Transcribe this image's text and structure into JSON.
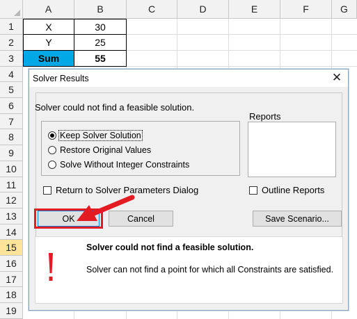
{
  "sheet": {
    "columns": [
      "A",
      "B",
      "C",
      "D",
      "E",
      "F",
      "G"
    ],
    "rows": [
      "1",
      "2",
      "3",
      "4",
      "5",
      "6",
      "7",
      "8",
      "9",
      "10",
      "11",
      "12",
      "13",
      "14",
      "15",
      "16",
      "17",
      "18",
      "19"
    ],
    "active_row": "15",
    "cells": {
      "a1": "X",
      "b1": "30",
      "a2": "Y",
      "b2": "25",
      "a3": "Sum",
      "b3": "55"
    },
    "sum_color": "#00a8e6",
    "active_row_color": "#ffe49a"
  },
  "dialog": {
    "title": "Solver Results",
    "close_icon": "close-icon",
    "message": "Solver could not find a feasible solution.",
    "reports_label": "Reports",
    "options": [
      {
        "label": "Keep Solver Solution",
        "selected": true
      },
      {
        "label": "Restore Original Values",
        "selected": false
      },
      {
        "label": "Solve Without Integer Constraints",
        "selected": false
      }
    ],
    "return_checkbox": "Return to Solver Parameters Dialog",
    "outline_checkbox": "Outline Reports",
    "ok": "OK",
    "cancel": "Cancel",
    "save_scenario": "Save Scenario...",
    "info_title": "Solver could not find a feasible solution.",
    "info_text": "Solver can not find a point for which all Constraints are satisfied.",
    "warning_icon": "exclamation-icon",
    "annotation_color": "#e31b23"
  }
}
